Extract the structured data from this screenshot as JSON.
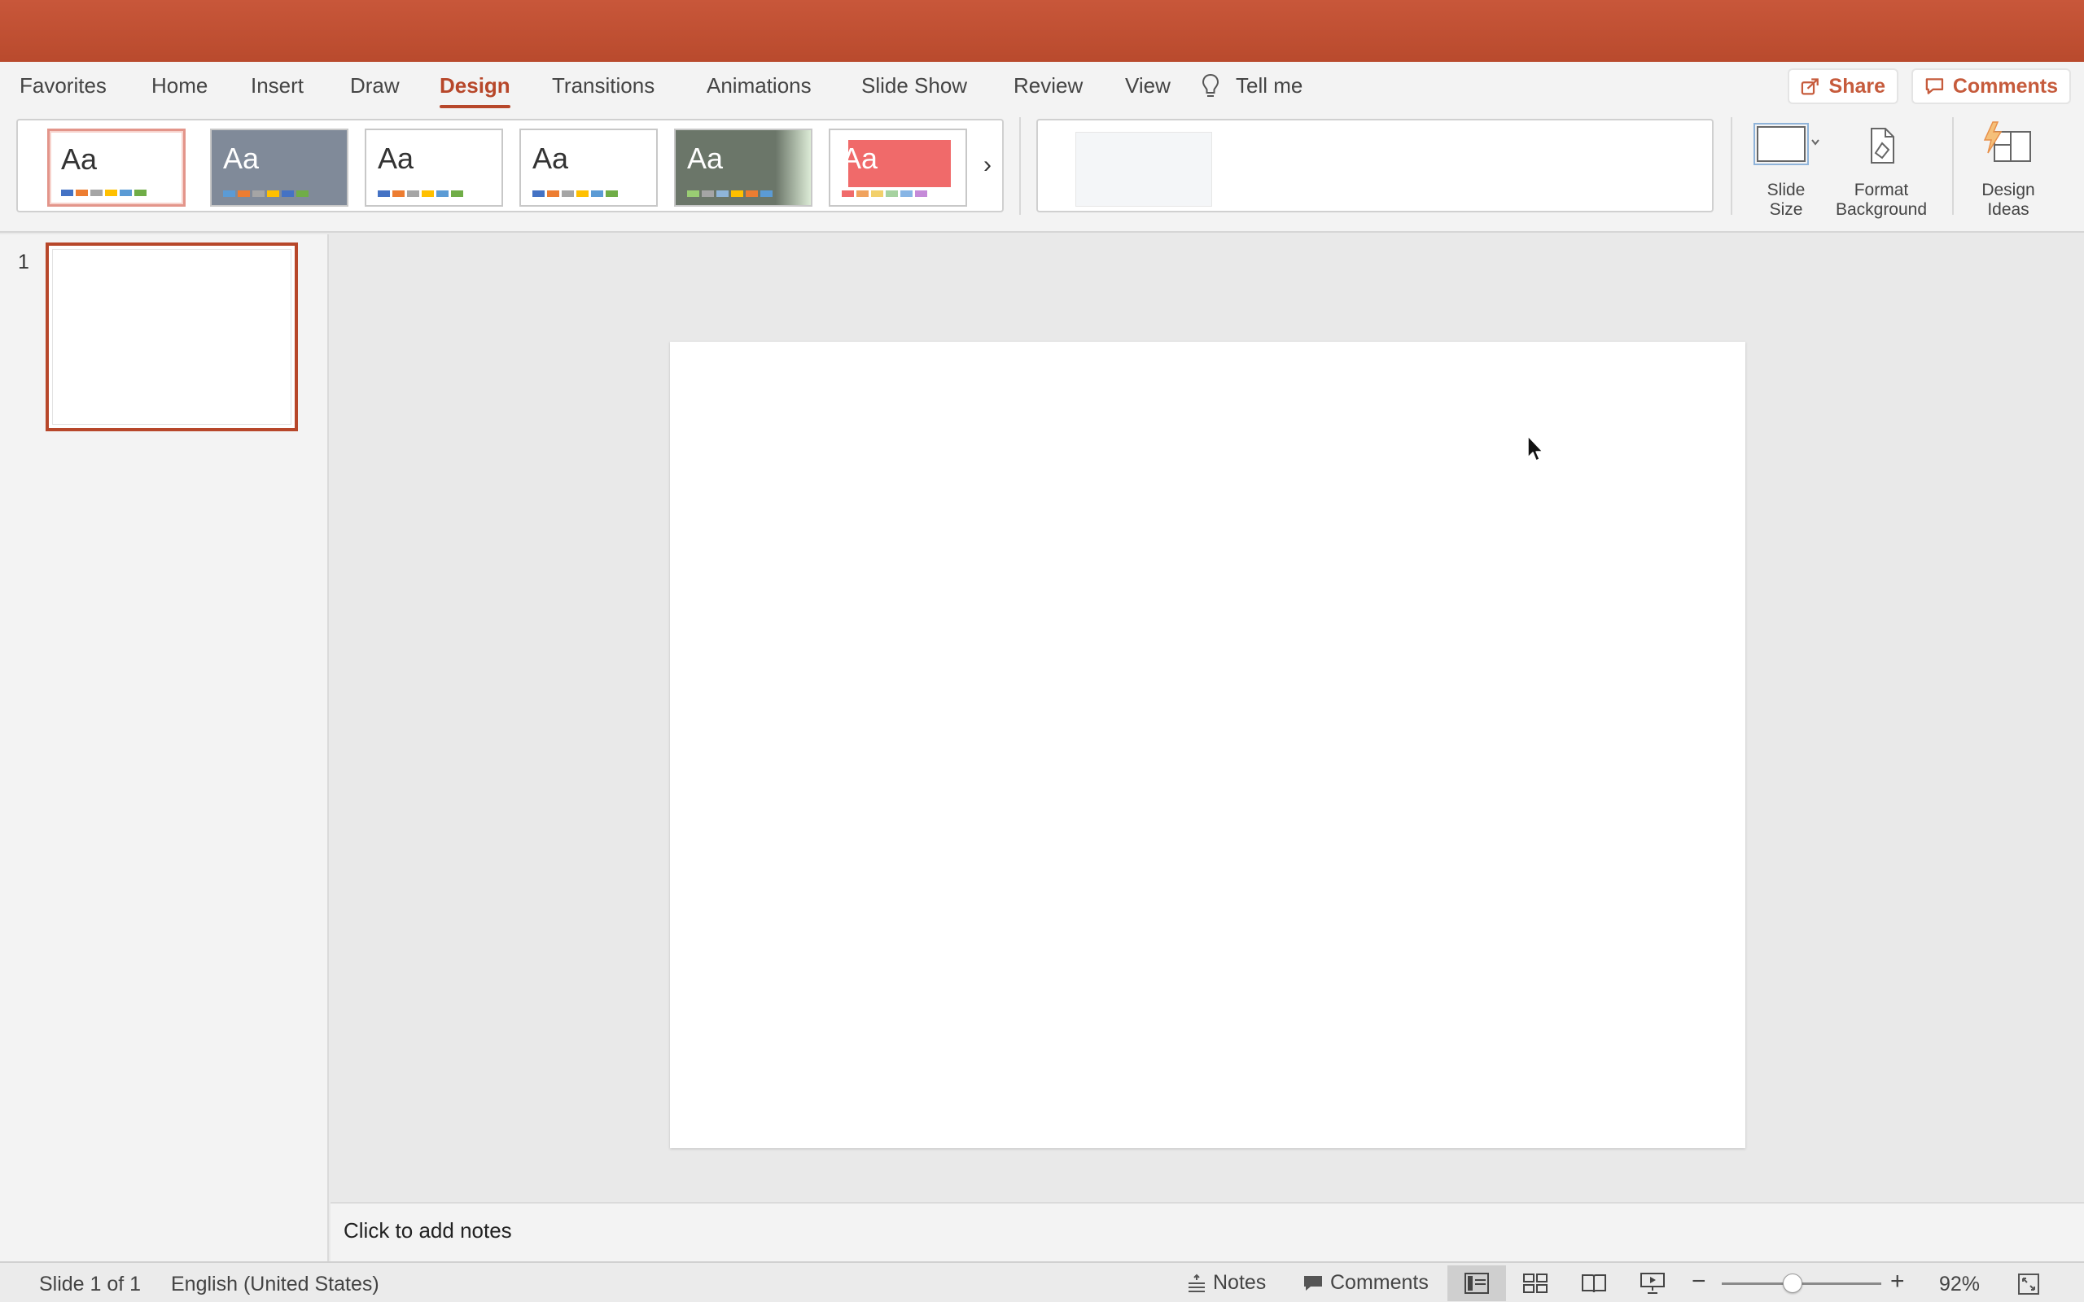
{
  "ribbon_tabs": [
    {
      "label": "Favorites"
    },
    {
      "label": "Home"
    },
    {
      "label": "Insert"
    },
    {
      "label": "Draw"
    },
    {
      "label": "Design",
      "active": true
    },
    {
      "label": "Transitions"
    },
    {
      "label": "Animations"
    },
    {
      "label": "Slide Show"
    },
    {
      "label": "Review"
    },
    {
      "label": "View"
    }
  ],
  "tell_me": {
    "label": "Tell me",
    "icon": "lightbulb-icon"
  },
  "share": {
    "label": "Share",
    "icon": "share-icon"
  },
  "comments_button": {
    "label": "Comments",
    "icon": "comment-icon"
  },
  "themes": [
    {
      "label": "Aa",
      "selected": true,
      "background": "#ffffff",
      "text_color": "#333333",
      "colors": [
        "#4472c4",
        "#ed7d31",
        "#a5a5a5",
        "#ffc000",
        "#5b9bd5",
        "#70ad47"
      ]
    },
    {
      "label": "Aa",
      "background": "#808a99",
      "text_color": "#ffffff",
      "colors": [
        "#5b9bd5",
        "#ed7d31",
        "#a5a5a5",
        "#ffc000",
        "#4472c4",
        "#70ad47"
      ]
    },
    {
      "label": "Aa",
      "background": "#ffffff",
      "text_color": "#333333",
      "colors": [
        "#4472c4",
        "#ed7d31",
        "#a5a5a5",
        "#ffc000",
        "#5b9bd5",
        "#70ad47"
      ]
    },
    {
      "label": "Aa",
      "background": "#ffffff",
      "text_color": "#333333",
      "colors": [
        "#4472c4",
        "#ed7d31",
        "#a5a5a5",
        "#ffc000",
        "#5b9bd5",
        "#70ad47"
      ]
    },
    {
      "label": "Aa",
      "background": "#6b7669",
      "text_color": "#ffffff",
      "colors": [
        "#9acd73",
        "#a5a5a5",
        "#8fb5d9",
        "#ffc000",
        "#ed7d31",
        "#5b9bd5"
      ]
    },
    {
      "label": "Aa",
      "background": "#ffffff",
      "text_color": "#ffffff",
      "accent": "#f06a6a",
      "colors": [
        "#f06a6a",
        "#f0a35e",
        "#f2d06b",
        "#a6d2a0",
        "#87b5e5",
        "#c58ad8"
      ]
    }
  ],
  "commands": [
    {
      "label_line1": "Slide",
      "label_line2": "Size",
      "icon": "slide-size-icon"
    },
    {
      "label_line1": "Format",
      "label_line2": "Background",
      "icon": "format-background-icon"
    },
    {
      "label_line1": "Design",
      "label_line2": "Ideas",
      "icon": "design-ideas-icon"
    }
  ],
  "slides": [
    {
      "number": "1"
    }
  ],
  "notes_placeholder": "Click to add notes",
  "status": {
    "slide_position": "Slide 1 of 1",
    "language": "English (United States)",
    "notes_label": "Notes",
    "comments_label": "Comments",
    "zoom": "92%",
    "zoom_level": 0.38
  },
  "colors": {
    "accent": "#b7472a",
    "titlebar": "#c0502f"
  }
}
